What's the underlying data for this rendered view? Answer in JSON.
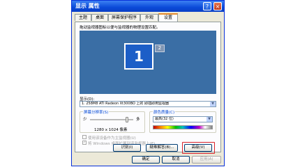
{
  "window": {
    "title": "显示 属性",
    "help_label": "?",
    "close_label": "×"
  },
  "tabs": [
    {
      "label": "主题"
    },
    {
      "label": "桌面"
    },
    {
      "label": "屏幕保护程序"
    },
    {
      "label": "外观"
    },
    {
      "label": "设置"
    }
  ],
  "settings": {
    "hint": "拖动监视器图标以便与监视器的物理设置匹配。",
    "monitor1_label": "1",
    "monitor2_label": "2",
    "display_label": "显示(D):",
    "display_value": "1. 258M8 ATI Radeon Xt300BO 上的 即插即用监视器",
    "resolution_group": "屏幕分辨率(S)",
    "res_less": "少",
    "res_more": "多",
    "resolution_value": "1280 x 1024 像素",
    "resolution_level": 0.85,
    "color_group": "颜色质量(C)",
    "color_value": "最高(32 位)",
    "primary_checkbox": "使用该设备作为主监视器(U)",
    "extend_checkbox": "将 Windows 桌面扩展到该监视器上(E)",
    "identify_button": "识别(I)",
    "troubleshoot_button": "疑难解答(B)...",
    "advanced_button": "高级(V)"
  },
  "footer": {
    "ok": "确定",
    "cancel": "取消",
    "apply": "应用(A)"
  },
  "colors": {
    "desktop": "#3a6ea5",
    "highlight": "#d8222a",
    "titlebar": "#0a4ad8"
  }
}
